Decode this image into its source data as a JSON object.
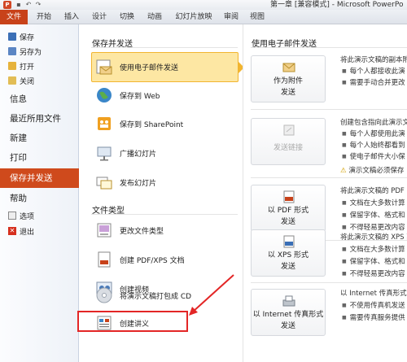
{
  "titlebar": {
    "app_icon": "P",
    "qat_icons": [
      "save-icon",
      "undo-icon",
      "redo-icon"
    ],
    "title": "第一章 [兼容模式] - Microsoft PowerPo"
  },
  "ribbon": {
    "file_tab": "文件",
    "tabs": [
      "开始",
      "插入",
      "设计",
      "切换",
      "动画",
      "幻灯片放映",
      "审阅",
      "视图"
    ]
  },
  "leftnav": {
    "items_small_top": [
      {
        "label": "保存",
        "icon": "save-icon"
      },
      {
        "label": "另存为",
        "icon": "save-as-icon"
      },
      {
        "label": "打开",
        "icon": "open-folder-icon"
      },
      {
        "label": "关闭",
        "icon": "close-file-icon"
      }
    ],
    "items_big": [
      "信息",
      "最近所用文件",
      "新建",
      "打印"
    ],
    "active": "保存并发送",
    "help": "帮助",
    "items_small_bottom": [
      {
        "label": "选项",
        "icon": "options-icon"
      },
      {
        "label": "退出",
        "icon": "exit-icon"
      }
    ]
  },
  "middle": {
    "section1_title": "保存并发送",
    "section1_items": [
      {
        "label": "使用电子邮件发送",
        "icon": "email-icon"
      },
      {
        "label": "保存到 Web",
        "icon": "globe-icon"
      },
      {
        "label": "保存到 SharePoint",
        "icon": "sharepoint-icon"
      },
      {
        "label": "广播幻灯片",
        "icon": "broadcast-icon"
      },
      {
        "label": "发布幻灯片",
        "icon": "publish-slides-icon"
      }
    ],
    "section2_title": "文件类型",
    "section2_items": [
      {
        "label": "更改文件类型",
        "icon": "change-file-type-icon"
      },
      {
        "label": "创建 PDF/XPS 文档",
        "icon": "pdf-document-icon"
      },
      {
        "label": "创建视频",
        "icon": "video-icon"
      },
      {
        "label": "将演示文稿打包成 CD",
        "icon": "cd-icon"
      },
      {
        "label": "创建讲义",
        "icon": "handout-icon"
      }
    ]
  },
  "right": {
    "title": "使用电子邮件发送",
    "blocks": [
      {
        "btn_l1": "作为附件",
        "btn_l2": "发送",
        "icon": "attachment-icon",
        "disabled": false,
        "desc": "将此演示文稿的副本附",
        "bullets": [
          "每个人都接收此演",
          "需要手动合并更改"
        ]
      },
      {
        "btn_l1": "发送链接",
        "btn_l2": "",
        "icon": "link-icon",
        "disabled": true,
        "desc": "创建包含指向此演示文",
        "bullets": [
          "每个人都使用此演",
          "每个人始终都看到",
          "使电子邮件大小保"
        ],
        "warning": "演示文稿必须保存"
      },
      {
        "btn_l1": "以 PDF 形式",
        "btn_l2": "发送",
        "icon": "pdf-icon",
        "disabled": false,
        "desc": "将此演示文稿的 PDF 副",
        "bullets": [
          "文档在大多数计算",
          "保留字体、格式和",
          "不得轻易更改内容"
        ]
      },
      {
        "btn_l1": "以 XPS 形式",
        "btn_l2": "发送",
        "icon": "xps-icon",
        "disabled": false,
        "desc": "将此演示文稿的 XPS 副",
        "bullets": [
          "文档在大多数计算",
          "保留字体、格式和",
          "不得轻易更改内容"
        ]
      },
      {
        "btn_l1": "以 Internet 传真形式",
        "btn_l2": "发送",
        "icon": "fax-icon",
        "disabled": false,
        "desc": "以 Internet 传真形式",
        "bullets": [
          "不使用传真机发送",
          "需要传真服务提供"
        ]
      }
    ]
  },
  "colors": {
    "file_tab": "#c8421a",
    "active_nav": "#cf4a1c",
    "selected_option": "#fde7a3",
    "annotation": "#e32626"
  }
}
